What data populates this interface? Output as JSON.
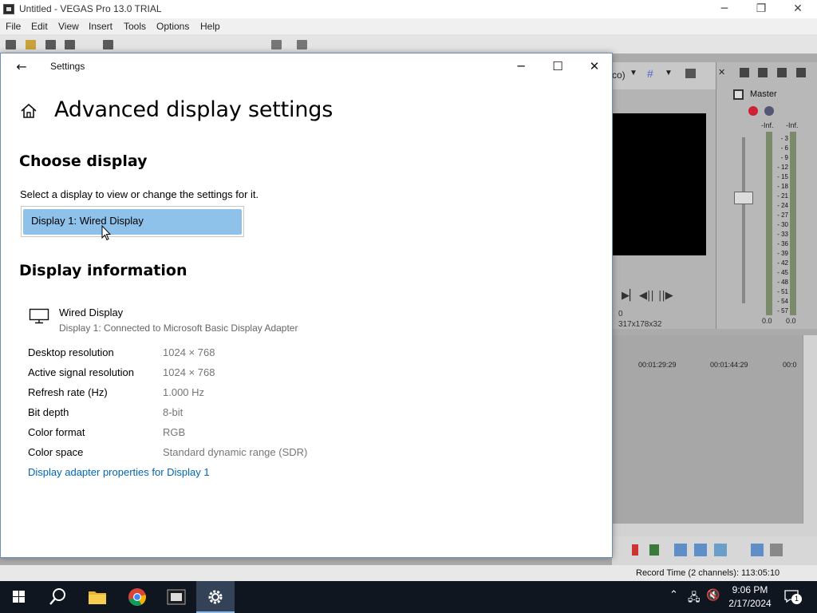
{
  "vegas": {
    "title": "Untitled - VEGAS Pro 13.0 TRIAL",
    "menu": [
      "File",
      "Edit",
      "View",
      "Insert",
      "Tools",
      "Options",
      "Help"
    ],
    "preview_mode_partial": "co)",
    "frame_number": "0",
    "preview_resolution": "317x178x32",
    "mixer": {
      "master_label": "Master",
      "inf_left": "-Inf.",
      "inf_right": "-Inf.",
      "scale": [
        "3",
        "6",
        "9",
        "12",
        "15",
        "18",
        "21",
        "24",
        "27",
        "30",
        "33",
        "36",
        "39",
        "42",
        "45",
        "48",
        "51",
        "54",
        "57"
      ],
      "zero_left": "0.0",
      "zero_right": "0.0"
    },
    "timeline": {
      "ruler": [
        "00:01:29:29",
        "00:01:44:29",
        "00:0"
      ]
    },
    "record_time": "Record Time (2 channels): 113:05:10"
  },
  "settings": {
    "app_title": "Settings",
    "back_icon": "back-arrow-icon",
    "page_title": "Advanced display settings",
    "choose_display_heading": "Choose display",
    "choose_display_desc": "Select a display to view or change the settings for it.",
    "selected_display": "Display 1: Wired Display",
    "display_info_heading": "Display information",
    "display_name": "Wired Display",
    "display_sub": "Display 1: Connected to Microsoft Basic Display Adapter",
    "rows": [
      {
        "label": "Desktop resolution",
        "value": "1024 × 768"
      },
      {
        "label": "Active signal resolution",
        "value": "1024 × 768"
      },
      {
        "label": "Refresh rate (Hz)",
        "value": "1.000 Hz"
      },
      {
        "label": "Bit depth",
        "value": "8-bit"
      },
      {
        "label": "Color format",
        "value": "RGB"
      },
      {
        "label": "Color space",
        "value": "Standard dynamic range (SDR)"
      }
    ],
    "adapter_link": "Display adapter properties for Display 1",
    "accent_color": "#0066b4",
    "selection_color": "#8ec2ea"
  },
  "taskbar": {
    "apps": [
      "start-icon",
      "search-icon",
      "file-explorer-icon",
      "chrome-icon",
      "vegas-icon",
      "settings-icon"
    ],
    "time": "9:06 PM",
    "date": "2/17/2024",
    "notification_count": "1"
  }
}
